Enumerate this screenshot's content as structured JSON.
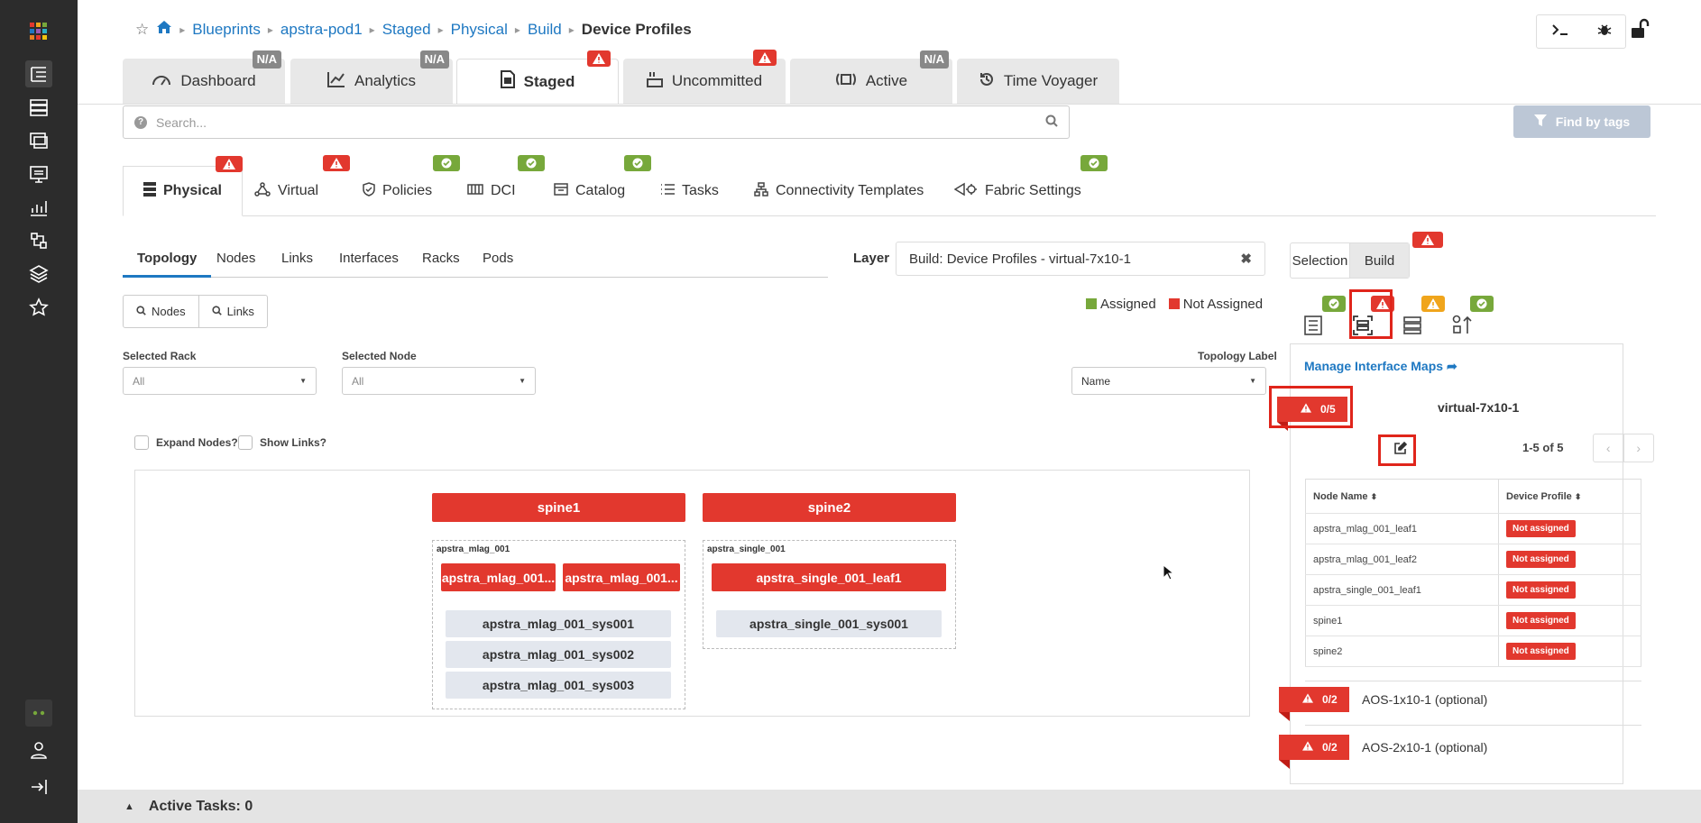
{
  "rail": {
    "icons": [
      "app-grid-icon",
      "blueprints-icon",
      "devices-icon",
      "design-icon",
      "resources-icon",
      "analytics-icon",
      "external-systems-icon",
      "platform-icon",
      "favorites-icon",
      "status-dots-icon",
      "user-icon",
      "collapse-icon"
    ]
  },
  "breadcrumb": {
    "items": [
      "Blueprints",
      "apstra-pod1",
      "Staged",
      "Physical",
      "Build"
    ],
    "current": "Device Profiles"
  },
  "stage_tabs": [
    {
      "label": "Dashboard",
      "badge": "N/A"
    },
    {
      "label": "Analytics",
      "badge": "N/A"
    },
    {
      "label": "Staged",
      "badge": "warning"
    },
    {
      "label": "Uncommitted",
      "badge": "warning"
    },
    {
      "label": "Active",
      "badge": "N/A"
    },
    {
      "label": "Time Voyager",
      "badge": ""
    }
  ],
  "search": {
    "placeholder": "Search..."
  },
  "find_by_tags": "Find by tags",
  "section_tabs": [
    "Physical",
    "Virtual",
    "Policies",
    "DCI",
    "Catalog",
    "Tasks",
    "Connectivity Templates",
    "Fabric Settings"
  ],
  "sub_tabs": [
    "Topology",
    "Nodes",
    "Links",
    "Interfaces",
    "Racks",
    "Pods"
  ],
  "layer": {
    "label": "Layer",
    "value": "Build: Device Profiles - virtual-7x10-1"
  },
  "legend": {
    "assigned": "Assigned",
    "not_assigned": "Not Assigned",
    "assigned_color": "#77a83b",
    "not_assigned_color": "#e2382e"
  },
  "buttons": {
    "nodes": "Nodes",
    "links": "Links"
  },
  "filters": {
    "rack_label": "Selected Rack",
    "rack_value": "All",
    "node_label": "Selected Node",
    "node_value": "All",
    "topo_label": "Topology Label",
    "topo_value": "Name"
  },
  "checkboxes": {
    "expand": "Expand Nodes?",
    "links": "Show Links?"
  },
  "topology": {
    "spines": [
      "spine1",
      "spine2"
    ],
    "rack1": {
      "name": "apstra_mlag_001",
      "leafs": [
        "apstra_mlag_001...",
        "apstra_mlag_001..."
      ],
      "systems": [
        "apstra_mlag_001_sys001",
        "apstra_mlag_001_sys002",
        "apstra_mlag_001_sys003"
      ]
    },
    "rack2": {
      "name": "apstra_single_001",
      "leafs": [
        "apstra_single_001_leaf1"
      ],
      "systems": [
        "apstra_single_001_sys001"
      ]
    }
  },
  "right_panel": {
    "tabs": [
      "Selection",
      "Build"
    ],
    "manage_link": "Manage Interface Maps",
    "group1": {
      "count": "0/5",
      "name": "virtual-7x10-1"
    },
    "pagination": "1-5 of 5",
    "table": {
      "headers": [
        "Node Name",
        "Device Profile"
      ],
      "rows": [
        {
          "node": "apstra_mlag_001_leaf1",
          "profile": "Not assigned"
        },
        {
          "node": "apstra_mlag_001_leaf2",
          "profile": "Not assigned"
        },
        {
          "node": "apstra_single_001_leaf1",
          "profile": "Not assigned"
        },
        {
          "node": "spine1",
          "profile": "Not assigned"
        },
        {
          "node": "spine2",
          "profile": "Not assigned"
        }
      ]
    },
    "group2": {
      "count": "0/2",
      "name": "AOS-1x10-1 (optional)"
    },
    "group3": {
      "count": "0/2",
      "name": "AOS-2x10-1 (optional)"
    }
  },
  "bottom_bar": {
    "label": "Active Tasks: 0"
  }
}
